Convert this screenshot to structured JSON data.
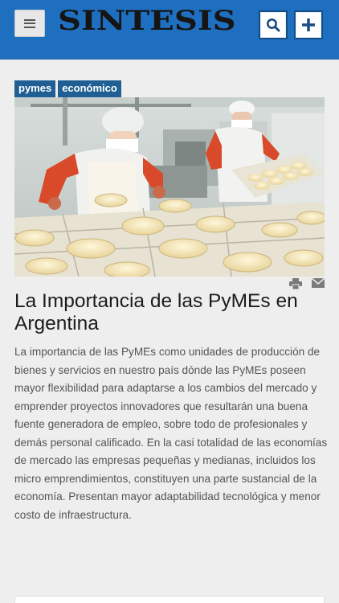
{
  "header": {
    "logo_text": "SINTESIS",
    "bg_color": "#1f6fc1",
    "icons": [
      "menu-icon",
      "search-icon",
      "plus-icon"
    ]
  },
  "tags": [
    "pymes",
    "económico"
  ],
  "article": {
    "title": "La Importancia de las PyMEs en Argentina",
    "body": "La importancia de las PyMEs como unidades de producción de bienes y servicios en nuestro país dónde las PyMEs poseen mayor flexibilidad para adaptarse a los cambios del mercado y emprender proyectos innovadores que resultarán una buena fuente generadora de empleo, sobre todo de profesionales y demás personal calificado. En la casi totalidad de las economías de mercado las empresas pequeñas y medianas, incluidos los micro emprendimientos, constituyen una parte sustancial de la economía. Presentan mayor adaptabilidad tecnológica y menor costo de infraestructura.",
    "tools": [
      "print-icon",
      "email-icon"
    ]
  }
}
